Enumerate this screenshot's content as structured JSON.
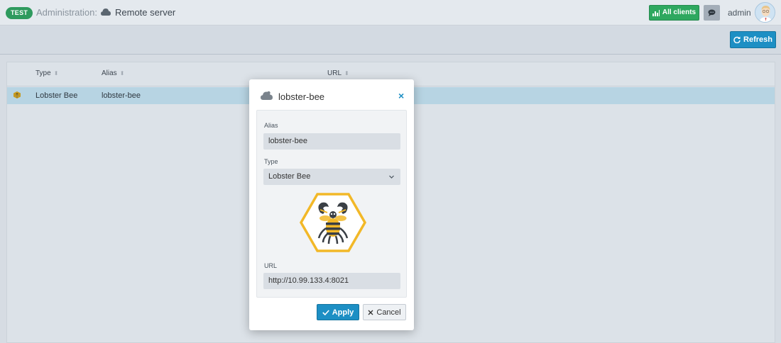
{
  "header": {
    "env_badge": "TEST",
    "breadcrumb_admin": "Administration:",
    "breadcrumb_page": "Remote server",
    "all_clients_label": "All clients",
    "user_name": "admin"
  },
  "toolbar": {
    "refresh_label": "Refresh"
  },
  "table": {
    "columns": [
      "Type",
      "Alias",
      "URL"
    ],
    "rows": [
      {
        "type": "Lobster Bee",
        "alias": "lobster-bee",
        "url": ""
      }
    ]
  },
  "modal": {
    "title": "lobster-bee",
    "close_glyph": "×",
    "alias_label": "Alias",
    "alias_value": "lobster-bee",
    "type_label": "Type",
    "type_value": "Lobster Bee",
    "url_label": "URL",
    "url_value": "http://10.99.133.4:8021",
    "apply_label": "Apply",
    "cancel_label": "Cancel"
  },
  "colors": {
    "badge_green": "#2e9a5e",
    "all_clients_green": "#2ea85f",
    "primary_blue": "#1d8fc4",
    "selected_row": "#b7d4e3",
    "hex_yellow": "#f2b828"
  },
  "icons": {
    "remote_server": "cloud-icon",
    "all_clients": "chart-icon",
    "chat": "comment-icon",
    "refresh": "refresh-icon",
    "sort": "sort-icon",
    "row_type": "bee-icon",
    "close": "close-icon",
    "apply": "check-icon",
    "cancel": "x-icon",
    "select": "chevron-down-icon"
  }
}
